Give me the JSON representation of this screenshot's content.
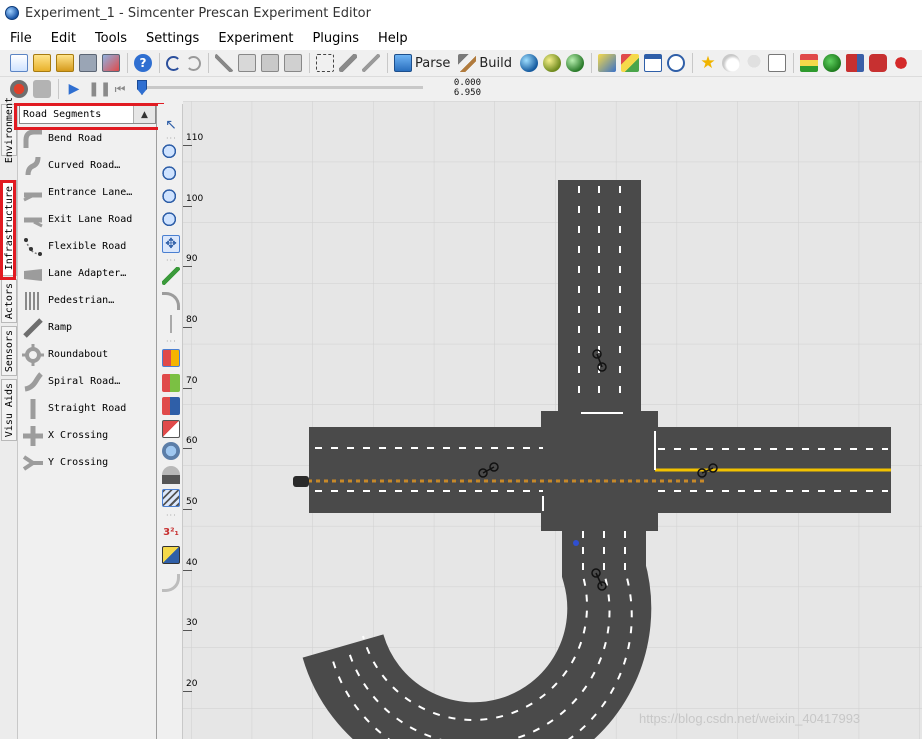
{
  "window": {
    "title": "Experiment_1 - Simcenter Prescan Experiment Editor"
  },
  "menu": [
    "File",
    "Edit",
    "Tools",
    "Settings",
    "Experiment",
    "Plugins",
    "Help"
  ],
  "toolbar": {
    "parse_label": "Parse",
    "build_label": "Build"
  },
  "playback": {
    "time_start": "0.000",
    "time_end": "6.950"
  },
  "side_tabs": [
    "Environment",
    "Infrastructure",
    "Actors",
    "Sensors",
    "Visu Aids"
  ],
  "library": {
    "selected": "Road Segments",
    "items": [
      "Bend Road",
      "Curved Road…",
      "Entrance Lane…",
      "Exit Lane Road",
      "Flexible Road",
      "Lane Adapter…",
      "Pedestrian…",
      "Ramp",
      "Roundabout",
      "Spiral Road…",
      "Straight Road",
      "X Crossing",
      "Y Crossing"
    ]
  },
  "ruler": [
    "110",
    "100",
    "90",
    "80",
    "70",
    "60",
    "50",
    "40",
    "30",
    "20"
  ],
  "watermark": "https://blog.csdn.net/weixin_40417993",
  "colors": {
    "asphalt": "#4a4a4a",
    "highlight": "#e11b22",
    "yellow_line": "#f2c200",
    "grid_bg": "#e6e6e6"
  }
}
